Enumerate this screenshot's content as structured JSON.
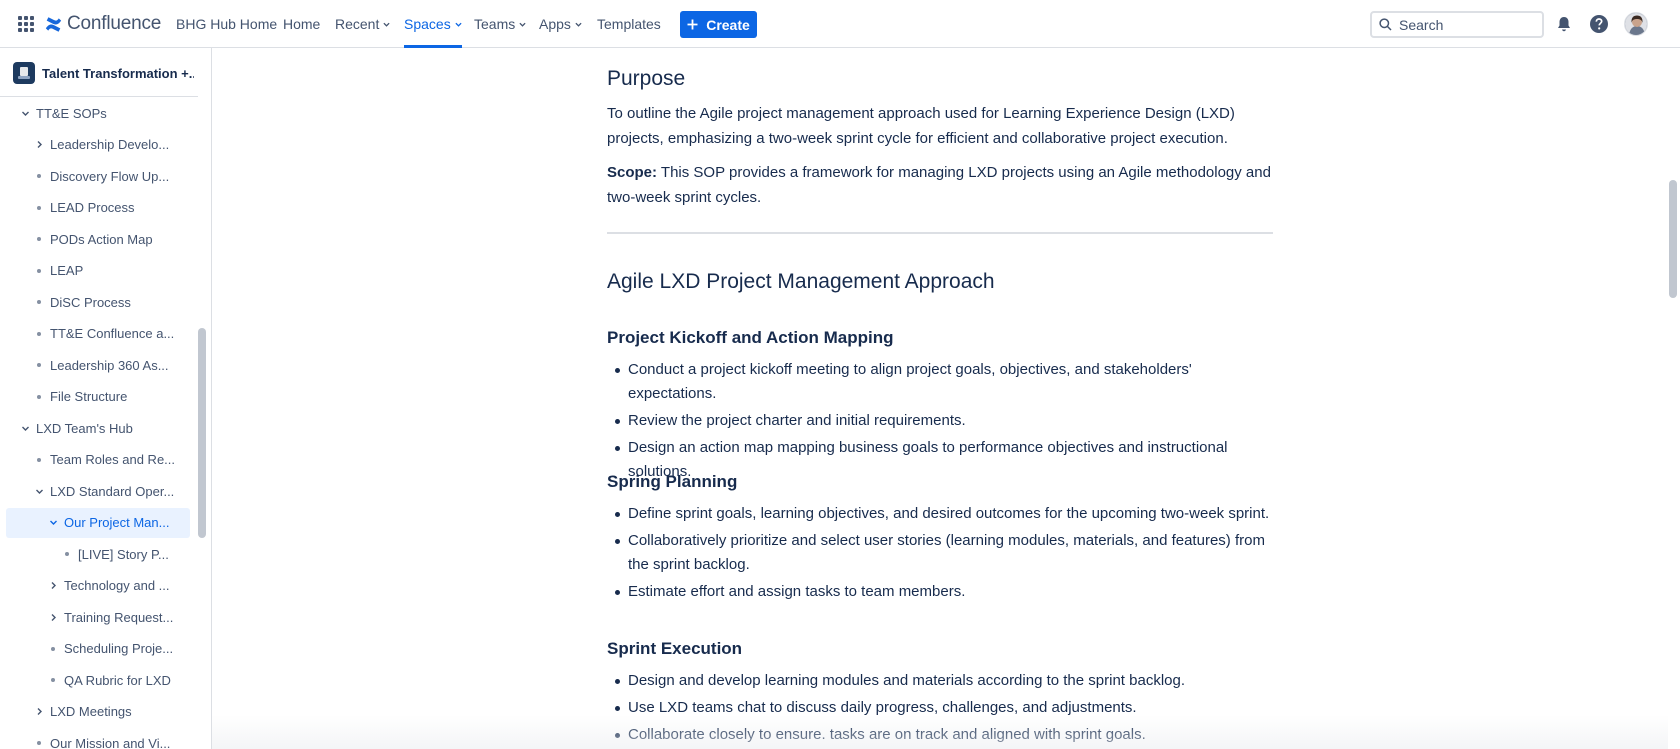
{
  "topnav": {
    "app_name": "Confluence",
    "items": [
      {
        "label": "BHG Hub Home"
      },
      {
        "label": "Home"
      },
      {
        "label": "Recent"
      },
      {
        "label": "Spaces"
      },
      {
        "label": "Teams"
      },
      {
        "label": "Apps"
      },
      {
        "label": "Templates"
      }
    ],
    "create_label": "Create",
    "search_placeholder": "Search",
    "icons": [
      "app-switcher-icon",
      "notifications-bell-icon",
      "help-icon",
      "profile-avatar"
    ],
    "accent_color": "#0c66e4"
  },
  "sidebar": {
    "space_name": "Talent Transformation +...",
    "tree": [
      {
        "label": "TT&E SOPs",
        "marker": "chevron-down"
      },
      {
        "label": "Leadership Develo...",
        "marker": "chevron-right"
      },
      {
        "label": "Discovery Flow Up...",
        "marker": "dot"
      },
      {
        "label": "LEAD Process",
        "marker": "dot"
      },
      {
        "label": "PODs Action Map",
        "marker": "dot"
      },
      {
        "label": "LEAP",
        "marker": "dot"
      },
      {
        "label": "DiSC Process",
        "marker": "dot"
      },
      {
        "label": "TT&E Confluence a...",
        "marker": "dot"
      },
      {
        "label": "Leadership 360 As...",
        "marker": "dot"
      },
      {
        "label": "File Structure",
        "marker": "dot"
      },
      {
        "label": "LXD Team's Hub",
        "marker": "chevron-down"
      },
      {
        "label": "Team Roles and Re...",
        "marker": "dot"
      },
      {
        "label": "LXD Standard Oper...",
        "marker": "chevron-down"
      },
      {
        "label": "Our Project Man...",
        "marker": "chevron-down",
        "selected": true
      },
      {
        "label": "[LIVE] Story P...",
        "marker": "dot"
      },
      {
        "label": "Technology and ...",
        "marker": "chevron-right"
      },
      {
        "label": "Training Request...",
        "marker": "chevron-right"
      },
      {
        "label": "Scheduling Proje...",
        "marker": "dot"
      },
      {
        "label": "QA Rubric for LXD",
        "marker": "dot"
      },
      {
        "label": "LXD Meetings",
        "marker": "chevron-right"
      },
      {
        "label": "Our Mission and Vi...",
        "marker": "dot"
      }
    ]
  },
  "content": {
    "purpose_heading": "Purpose",
    "purpose_text": "To outline the Agile project management approach used for Learning Experience Design (LXD) projects, emphasizing a two-week sprint cycle for efficient and collaborative project execution.",
    "scope_label": "Scope:",
    "scope_text": " This SOP provides a framework for managing LXD projects using an Agile methodology and two-week sprint cycles.",
    "approach_heading": "Agile LXD Project Management Approach",
    "sections": [
      {
        "heading": "Project Kickoff and Action Mapping",
        "items": [
          "Conduct a project kickoff meeting to align project goals, objectives, and stakeholders' expectations.",
          "Review the project charter and initial requirements.",
          "Design an action map mapping business goals to performance objectives and instructional solutions."
        ]
      },
      {
        "heading": "Spring Planning",
        "items": [
          "Define sprint goals, learning objectives, and desired outcomes for the upcoming two-week sprint.",
          "Collaboratively prioritize and select user stories (learning modules, materials, and features) from the sprint backlog.",
          "Estimate effort and assign tasks to team members."
        ]
      },
      {
        "heading": "Sprint Execution",
        "items": [
          "Design and develop learning modules and materials according to the sprint backlog.",
          "Use LXD teams chat to discuss daily progress, challenges, and adjustments.",
          "Collaborate closely to ensure. tasks are on track and aligned with sprint goals."
        ]
      }
    ]
  }
}
